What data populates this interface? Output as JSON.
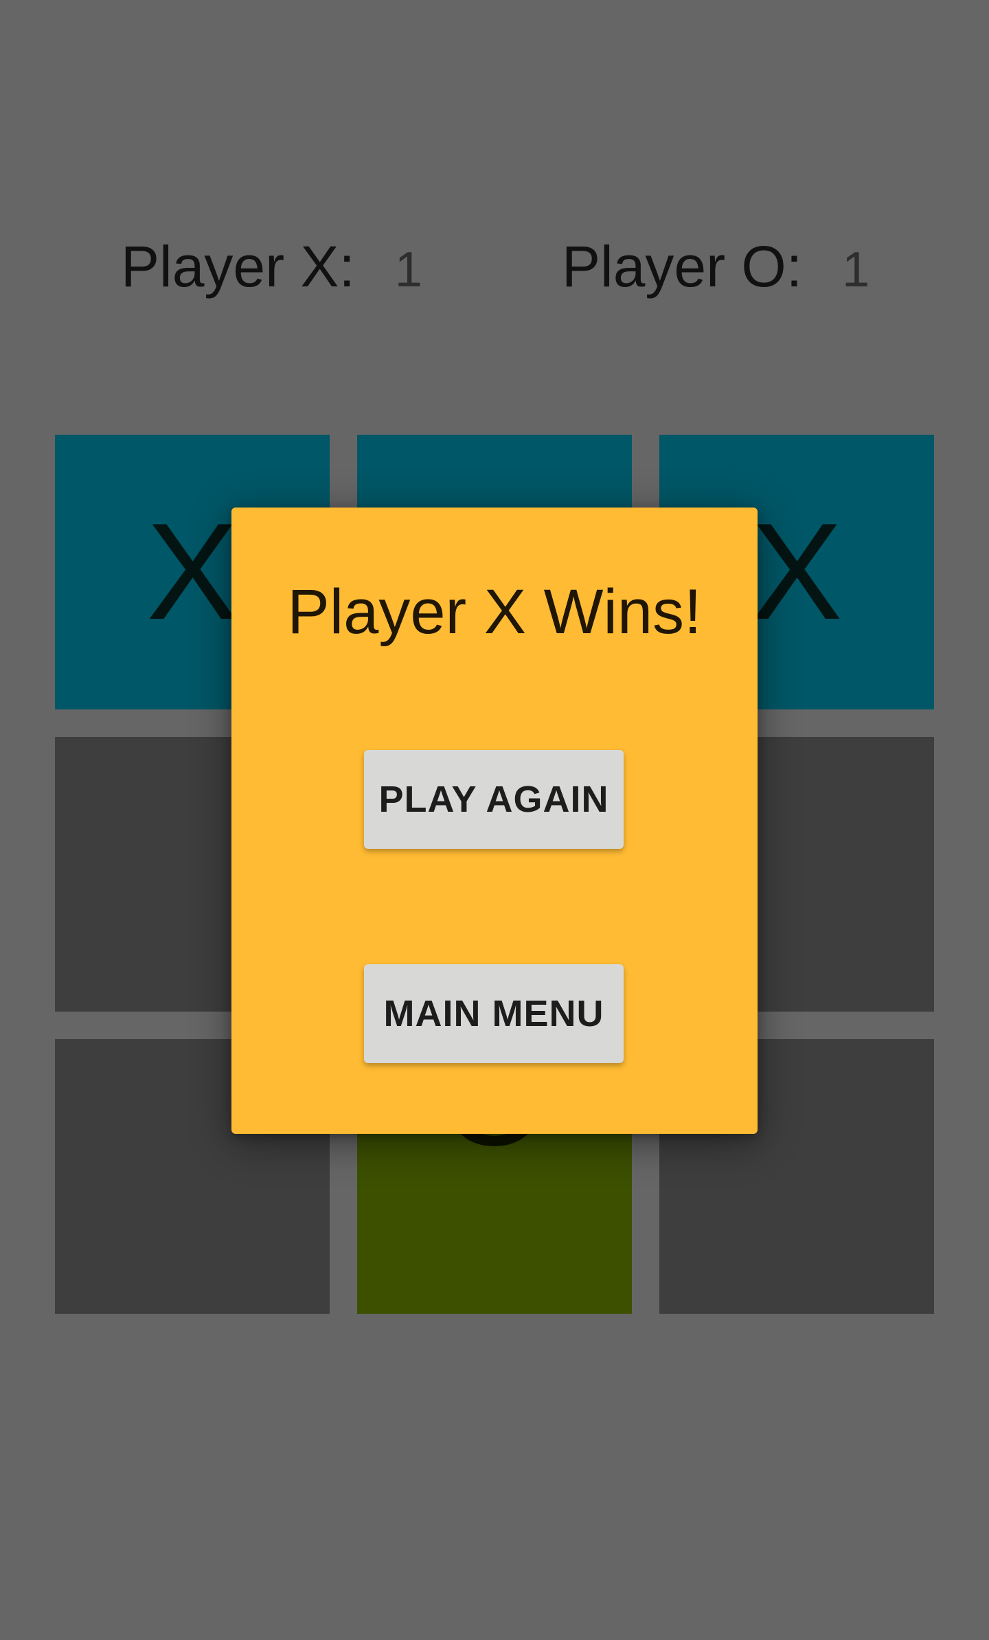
{
  "scoreboard": {
    "player_x_label": "Player X:",
    "player_x_score": "1",
    "player_o_label": "Player O:",
    "player_o_score": "1"
  },
  "board": {
    "cells": [
      {
        "mark": "X",
        "color": "#005767"
      },
      {
        "mark": "",
        "color": "#005767"
      },
      {
        "mark": "X",
        "color": "#005767"
      },
      {
        "mark": "",
        "color": "#3e3e3e"
      },
      {
        "mark": "",
        "color": "#3e3e3e"
      },
      {
        "mark": "",
        "color": "#3e3e3e"
      },
      {
        "mark": "",
        "color": "#3e3e3e"
      },
      {
        "mark": "O",
        "color": "#3c5000"
      },
      {
        "mark": "",
        "color": "#3e3e3e"
      }
    ]
  },
  "dialog": {
    "title": "Player X Wins!",
    "play_again_label": "PLAY AGAIN",
    "main_menu_label": "MAIN MENU",
    "background_color": "#ffbb33"
  },
  "colors": {
    "background": "#666666",
    "winner_tile": "#005767",
    "o_tile": "#3c5000",
    "empty_tile": "#3e3e3e",
    "button": "#d8d9d7"
  }
}
